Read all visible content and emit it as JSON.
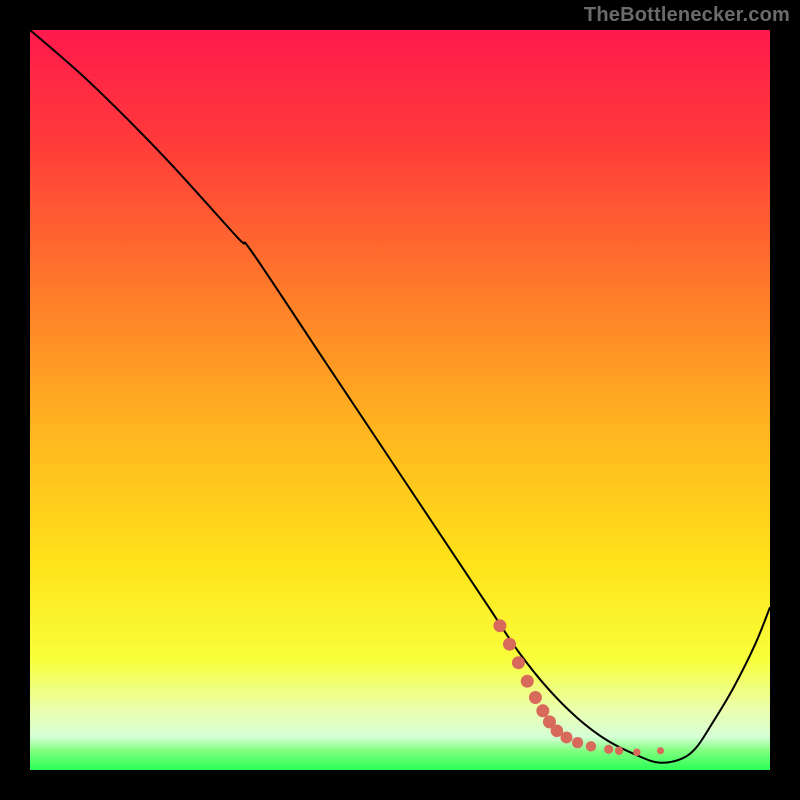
{
  "attribution": "TheBottlenecker.com",
  "colors": {
    "frame": "#000000",
    "gradient_stops": [
      {
        "offset": 0.0,
        "color": "#ff1a4d"
      },
      {
        "offset": 0.15,
        "color": "#ff3a3a"
      },
      {
        "offset": 0.35,
        "color": "#ff7a2a"
      },
      {
        "offset": 0.55,
        "color": "#ffb81f"
      },
      {
        "offset": 0.72,
        "color": "#ffe21a"
      },
      {
        "offset": 0.85,
        "color": "#f8ff3a"
      },
      {
        "offset": 0.92,
        "color": "#eaffb0"
      },
      {
        "offset": 0.955,
        "color": "#d6ffd6"
      },
      {
        "offset": 0.975,
        "color": "#7dff7d"
      },
      {
        "offset": 1.0,
        "color": "#2bff57"
      }
    ],
    "curve": "#000000",
    "marker": "#d86a5b"
  },
  "chart_data": {
    "type": "line",
    "title": "",
    "xlabel": "",
    "ylabel": "",
    "xlim": [
      0,
      100
    ],
    "ylim": [
      0,
      100
    ],
    "series": [
      {
        "name": "bottleneck-curve",
        "x": [
          0,
          8,
          18,
          28,
          30,
          40,
          50,
          58,
          62,
          66,
          70,
          74,
          78,
          82,
          85,
          88,
          90,
          92,
          95,
          98,
          100
        ],
        "y": [
          100,
          93,
          83,
          72,
          70,
          55,
          40,
          28,
          22,
          16,
          11,
          7,
          4,
          2,
          1,
          1.5,
          3,
          6,
          11,
          17,
          22
        ]
      }
    ],
    "markers": {
      "name": "highlight-dots",
      "points": [
        {
          "x": 63.5,
          "y": 19.5,
          "r": 6.5
        },
        {
          "x": 64.8,
          "y": 17.0,
          "r": 6.5
        },
        {
          "x": 66.0,
          "y": 14.5,
          "r": 6.5
        },
        {
          "x": 67.2,
          "y": 12.0,
          "r": 6.5
        },
        {
          "x": 68.3,
          "y": 9.8,
          "r": 6.5
        },
        {
          "x": 69.3,
          "y": 8.0,
          "r": 6.5
        },
        {
          "x": 70.2,
          "y": 6.5,
          "r": 6.5
        },
        {
          "x": 71.2,
          "y": 5.3,
          "r": 6.3
        },
        {
          "x": 72.5,
          "y": 4.4,
          "r": 6.0
        },
        {
          "x": 74.0,
          "y": 3.7,
          "r": 5.6
        },
        {
          "x": 75.8,
          "y": 3.2,
          "r": 5.2
        },
        {
          "x": 78.2,
          "y": 2.8,
          "r": 4.6
        },
        {
          "x": 79.6,
          "y": 2.6,
          "r": 4.2
        },
        {
          "x": 82.0,
          "y": 2.4,
          "r": 3.8
        },
        {
          "x": 85.2,
          "y": 2.6,
          "r": 3.6
        }
      ]
    }
  }
}
